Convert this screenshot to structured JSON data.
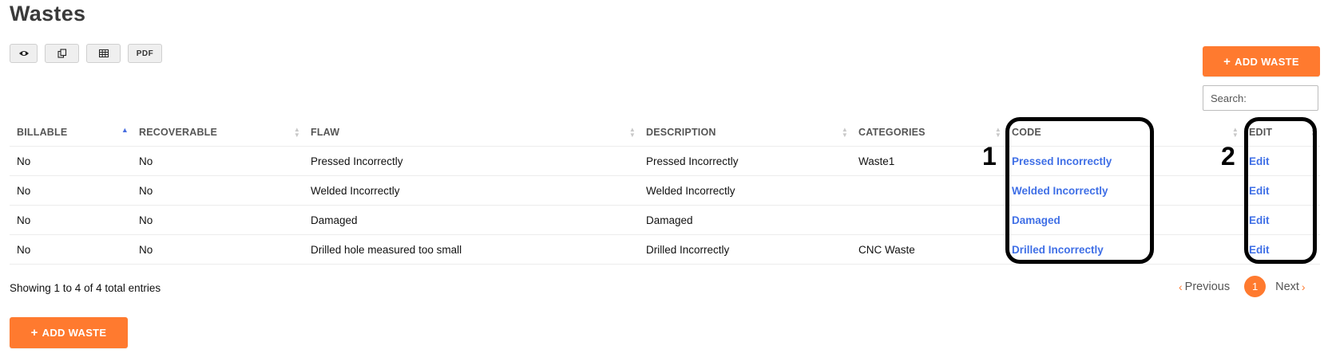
{
  "page": {
    "title": "Wastes"
  },
  "toolbar": {
    "buttons": [
      {
        "icon": "eye-icon",
        "label": ""
      },
      {
        "icon": "copy-icon",
        "label": ""
      },
      {
        "icon": "table-icon",
        "label": ""
      },
      {
        "icon": "",
        "label": "PDF"
      }
    ]
  },
  "actions": {
    "add_label": "ADD WASTE",
    "add_icon": "+"
  },
  "search": {
    "placeholder": "Search:"
  },
  "table": {
    "columns": [
      "BILLABLE",
      "RECOVERABLE",
      "FLAW",
      "DESCRIPTION",
      "CATEGORIES",
      "CODE",
      "EDIT"
    ],
    "sorted_column": "BILLABLE",
    "rows": [
      {
        "billable": "No",
        "recoverable": "No",
        "flaw": "Pressed Incorrectly",
        "description": "Pressed Incorrectly",
        "categories": "Waste1",
        "code": "Pressed Incorrectly",
        "edit": "Edit"
      },
      {
        "billable": "No",
        "recoverable": "No",
        "flaw": "Welded Incorrectly",
        "description": "Welded Incorrectly",
        "categories": "",
        "code": "Welded Incorrectly",
        "edit": "Edit"
      },
      {
        "billable": "No",
        "recoverable": "No",
        "flaw": "Damaged",
        "description": "Damaged",
        "categories": "",
        "code": "Damaged",
        "edit": "Edit"
      },
      {
        "billable": "No",
        "recoverable": "No",
        "flaw": "Drilled hole measured too small",
        "description": "Drilled Incorrectly",
        "categories": "CNC Waste",
        "code": "Drilled Incorrectly",
        "edit": "Edit"
      }
    ]
  },
  "annotations": {
    "first": "1",
    "second": "2"
  },
  "footer": {
    "info": "Showing 1 to 4 of 4 total entries",
    "previous": "Previous",
    "next": "Next",
    "current_page": "1"
  },
  "colors": {
    "accent": "#ff7a2f",
    "link": "#3f6fe6"
  }
}
